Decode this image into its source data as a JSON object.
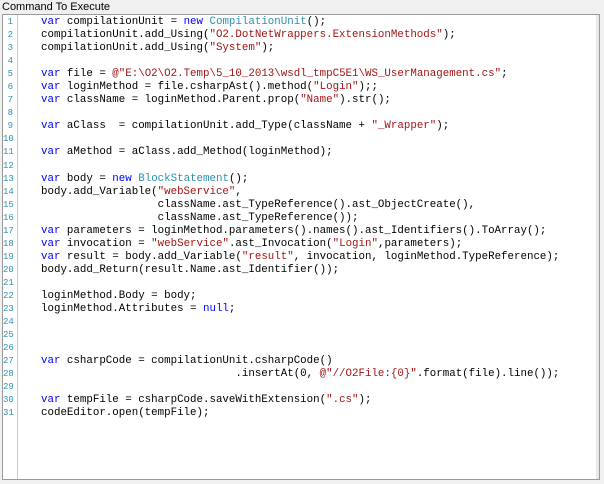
{
  "panel": {
    "title": "Command To Execute"
  },
  "colors": {
    "keyword": "#0000ff",
    "type": "#2b91af",
    "string": "#a31515",
    "line_number": "#2b91af",
    "text": "#000000"
  },
  "code_lines": [
    {
      "n": "1",
      "tokens": [
        {
          "t": "var",
          "c": "kw"
        },
        {
          "t": " compilationUnit = "
        },
        {
          "t": "new",
          "c": "kw"
        },
        {
          "t": " CompilationUnit",
          "c": "ty"
        },
        {
          "t": "();"
        }
      ]
    },
    {
      "n": "2",
      "tokens": [
        {
          "t": "compilationUnit.add_Using("
        },
        {
          "t": "\"O2.DotNetWrappers.ExtensionMethods\"",
          "c": "st"
        },
        {
          "t": ");"
        }
      ]
    },
    {
      "n": "3",
      "tokens": [
        {
          "t": "compilationUnit.add_Using("
        },
        {
          "t": "\"System\"",
          "c": "st"
        },
        {
          "t": ");"
        }
      ]
    },
    {
      "n": "4",
      "tokens": []
    },
    {
      "n": "5",
      "tokens": [
        {
          "t": "var",
          "c": "kw"
        },
        {
          "t": " file = "
        },
        {
          "t": "@\"E:\\O2\\O2.Temp\\5_10_2013\\wsdl_tmpC5E1\\WS_UserManagement.cs\"",
          "c": "st"
        },
        {
          "t": ";"
        }
      ]
    },
    {
      "n": "6",
      "tokens": [
        {
          "t": "var",
          "c": "kw"
        },
        {
          "t": " loginMethod = file.csharpAst().method("
        },
        {
          "t": "\"Login\"",
          "c": "st"
        },
        {
          "t": ");;"
        }
      ]
    },
    {
      "n": "7",
      "tokens": [
        {
          "t": "var",
          "c": "kw"
        },
        {
          "t": " className = loginMethod.Parent.prop("
        },
        {
          "t": "\"Name\"",
          "c": "st"
        },
        {
          "t": ").str();"
        }
      ]
    },
    {
      "n": "8",
      "tokens": []
    },
    {
      "n": "9",
      "tokens": [
        {
          "t": "var",
          "c": "kw"
        },
        {
          "t": " aClass  = compilationUnit.add_Type(className + "
        },
        {
          "t": "\"_Wrapper\"",
          "c": "st"
        },
        {
          "t": ");"
        }
      ]
    },
    {
      "n": "10",
      "tokens": []
    },
    {
      "n": "11",
      "tokens": [
        {
          "t": "var",
          "c": "kw"
        },
        {
          "t": " aMethod = aClass.add_Method(loginMethod);"
        }
      ]
    },
    {
      "n": "12",
      "tokens": []
    },
    {
      "n": "13",
      "tokens": [
        {
          "t": "var",
          "c": "kw"
        },
        {
          "t": " body = "
        },
        {
          "t": "new",
          "c": "kw"
        },
        {
          "t": " BlockStatement",
          "c": "ty"
        },
        {
          "t": "();"
        }
      ]
    },
    {
      "n": "14",
      "tokens": [
        {
          "t": "body.add_Variable("
        },
        {
          "t": "\"webService\"",
          "c": "st"
        },
        {
          "t": ","
        }
      ]
    },
    {
      "n": "15",
      "tokens": [
        {
          "t": "                  className.ast_TypeReference().ast_ObjectCreate(),"
        }
      ]
    },
    {
      "n": "16",
      "tokens": [
        {
          "t": "                  className.ast_TypeReference());"
        }
      ]
    },
    {
      "n": "17",
      "tokens": [
        {
          "t": "var",
          "c": "kw"
        },
        {
          "t": " parameters = loginMethod.parameters().names().ast_Identifiers().ToArray();"
        }
      ]
    },
    {
      "n": "18",
      "tokens": [
        {
          "t": "var",
          "c": "kw"
        },
        {
          "t": " invocation = "
        },
        {
          "t": "\"webService\"",
          "c": "st"
        },
        {
          "t": ".ast_Invocation("
        },
        {
          "t": "\"Login\"",
          "c": "st"
        },
        {
          "t": ",parameters);"
        }
      ]
    },
    {
      "n": "19",
      "tokens": [
        {
          "t": "var",
          "c": "kw"
        },
        {
          "t": " result = body.add_Variable("
        },
        {
          "t": "\"result\"",
          "c": "st"
        },
        {
          "t": ", invocation, loginMethod.TypeReference);"
        }
      ]
    },
    {
      "n": "20",
      "tokens": [
        {
          "t": "body.add_Return(result.Name.ast_Identifier());"
        }
      ]
    },
    {
      "n": "21",
      "tokens": []
    },
    {
      "n": "22",
      "tokens": [
        {
          "t": "loginMethod.Body = body;"
        }
      ]
    },
    {
      "n": "23",
      "tokens": [
        {
          "t": "loginMethod.Attributes = "
        },
        {
          "t": "null",
          "c": "kw"
        },
        {
          "t": ";"
        }
      ]
    },
    {
      "n": "24",
      "tokens": []
    },
    {
      "n": "25",
      "tokens": []
    },
    {
      "n": "26",
      "tokens": []
    },
    {
      "n": "27",
      "tokens": [
        {
          "t": "var",
          "c": "kw"
        },
        {
          "t": " csharpCode = compilationUnit.csharpCode()"
        }
      ]
    },
    {
      "n": "28",
      "tokens": [
        {
          "t": "                              .insertAt(0, "
        },
        {
          "t": "@\"//O2File:{0}\"",
          "c": "st"
        },
        {
          "t": ".format(file).line());"
        }
      ]
    },
    {
      "n": "29",
      "tokens": []
    },
    {
      "n": "30",
      "tokens": [
        {
          "t": "var",
          "c": "kw"
        },
        {
          "t": " tempFile = csharpCode.saveWithExtension("
        },
        {
          "t": "\".cs\"",
          "c": "st"
        },
        {
          "t": ");"
        }
      ]
    },
    {
      "n": "31",
      "tokens": [
        {
          "t": "codeEditor.open(tempFile);"
        }
      ]
    }
  ]
}
